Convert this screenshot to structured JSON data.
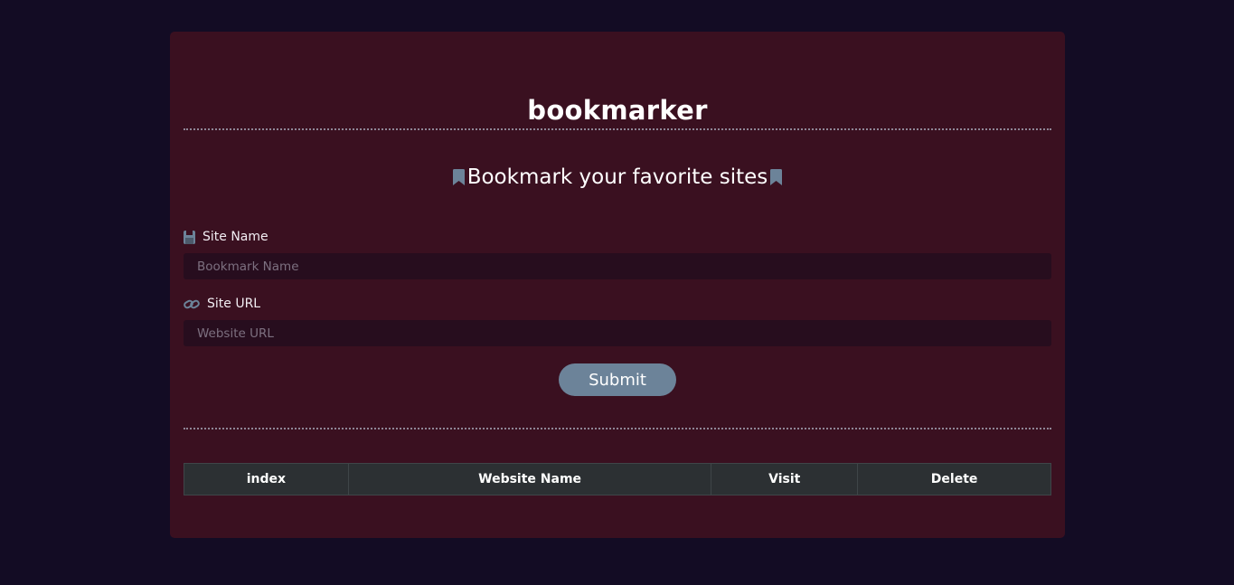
{
  "header": {
    "title": "bookmarker"
  },
  "form": {
    "heading": "Bookmark your favorite sites",
    "site_name": {
      "label": "Site Name",
      "placeholder": "Bookmark Name",
      "value": "",
      "icon": "save-icon"
    },
    "site_url": {
      "label": "Site URL",
      "placeholder": "Website URL",
      "value": "",
      "icon": "link-icon"
    },
    "submit_label": "Submit"
  },
  "table": {
    "columns": [
      "index",
      "Website Name",
      "Visit",
      "Delete"
    ],
    "rows": []
  },
  "colors": {
    "page_background": "#130c24",
    "card_background": "#3a1020",
    "input_background": "#270d1e",
    "accent": "#6c8399",
    "table_header": "#2c3033"
  }
}
